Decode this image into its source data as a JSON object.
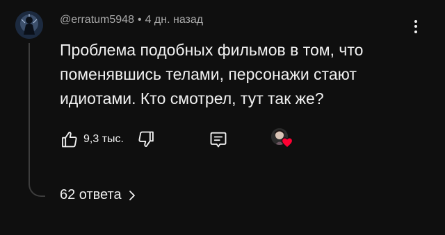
{
  "comment": {
    "author": "@erratum5948",
    "separator": "•",
    "time": "4 дн. назад",
    "text": "Проблема подобных фильмов в том, что поменявшись телами, персонажи стают идиотами. Кто смотрел, тут так же?",
    "like_count": "9,3 тыс.",
    "replies_label": "62 ответа",
    "heart_color": "#ff0033"
  },
  "icons": {
    "avatar": "user-avatar-dark-figure",
    "menu": "more-vert-icon",
    "like": "thumbs-up-icon",
    "dislike": "thumbs-down-icon",
    "reply": "reply-comment-icon",
    "creator": "creator-avatar",
    "heart": "heart-icon",
    "chevron": "chevron-right-icon"
  }
}
